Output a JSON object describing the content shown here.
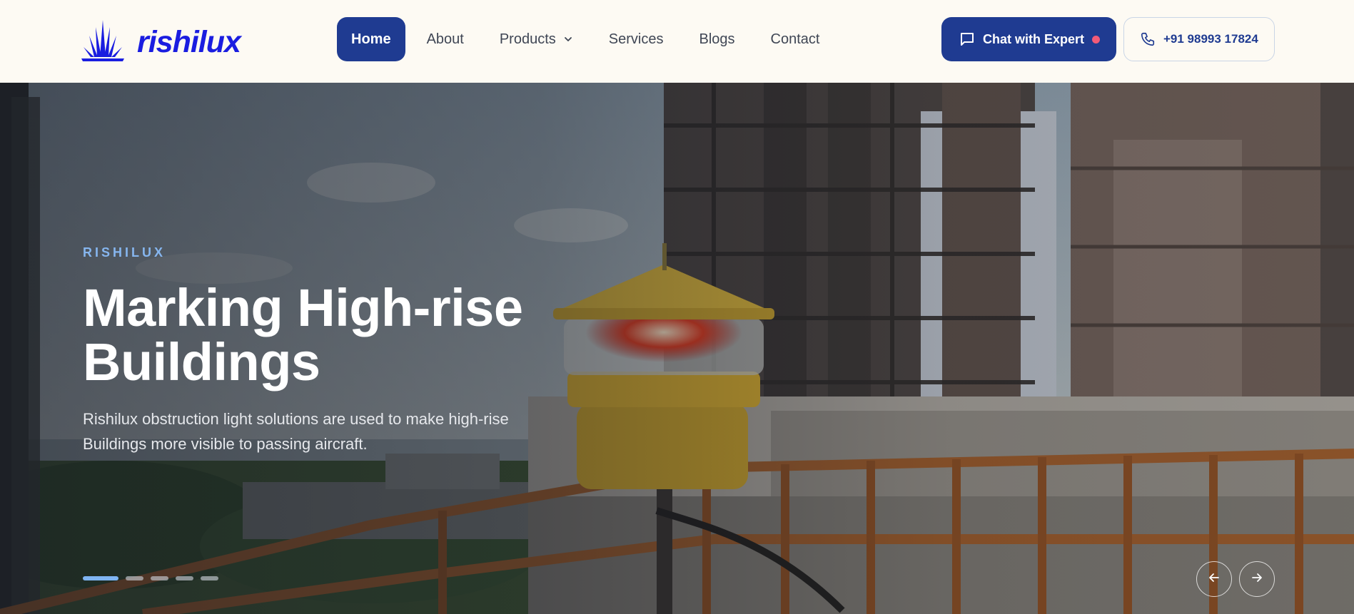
{
  "brand": {
    "name": "rishilux",
    "color": "#1a1de0"
  },
  "nav": {
    "items": [
      {
        "label": "Home",
        "active": true
      },
      {
        "label": "About"
      },
      {
        "label": "Products",
        "has_dropdown": true
      },
      {
        "label": "Services"
      },
      {
        "label": "Blogs"
      },
      {
        "label": "Contact"
      }
    ]
  },
  "actions": {
    "chat_label": "Chat with Expert",
    "chat_icon": "chat-bubble-icon",
    "chat_status_color": "#f25b78",
    "phone_label": "+91 98993 17824",
    "phone_icon": "phone-icon"
  },
  "hero": {
    "eyebrow": "RISHILUX",
    "title_line1": "Marking High-rise",
    "title_line2": "Buildings",
    "description": "Rishilux obstruction light solutions are used to make high-rise Buildings more visible to passing aircraft.",
    "slide_count": 5,
    "active_slide": 1,
    "prev_icon": "arrow-left-icon",
    "next_icon": "arrow-right-icon"
  },
  "colors": {
    "primary": "#1f3b91",
    "header_bg": "#fdfaf3",
    "accent_light": "#86b6ef"
  }
}
